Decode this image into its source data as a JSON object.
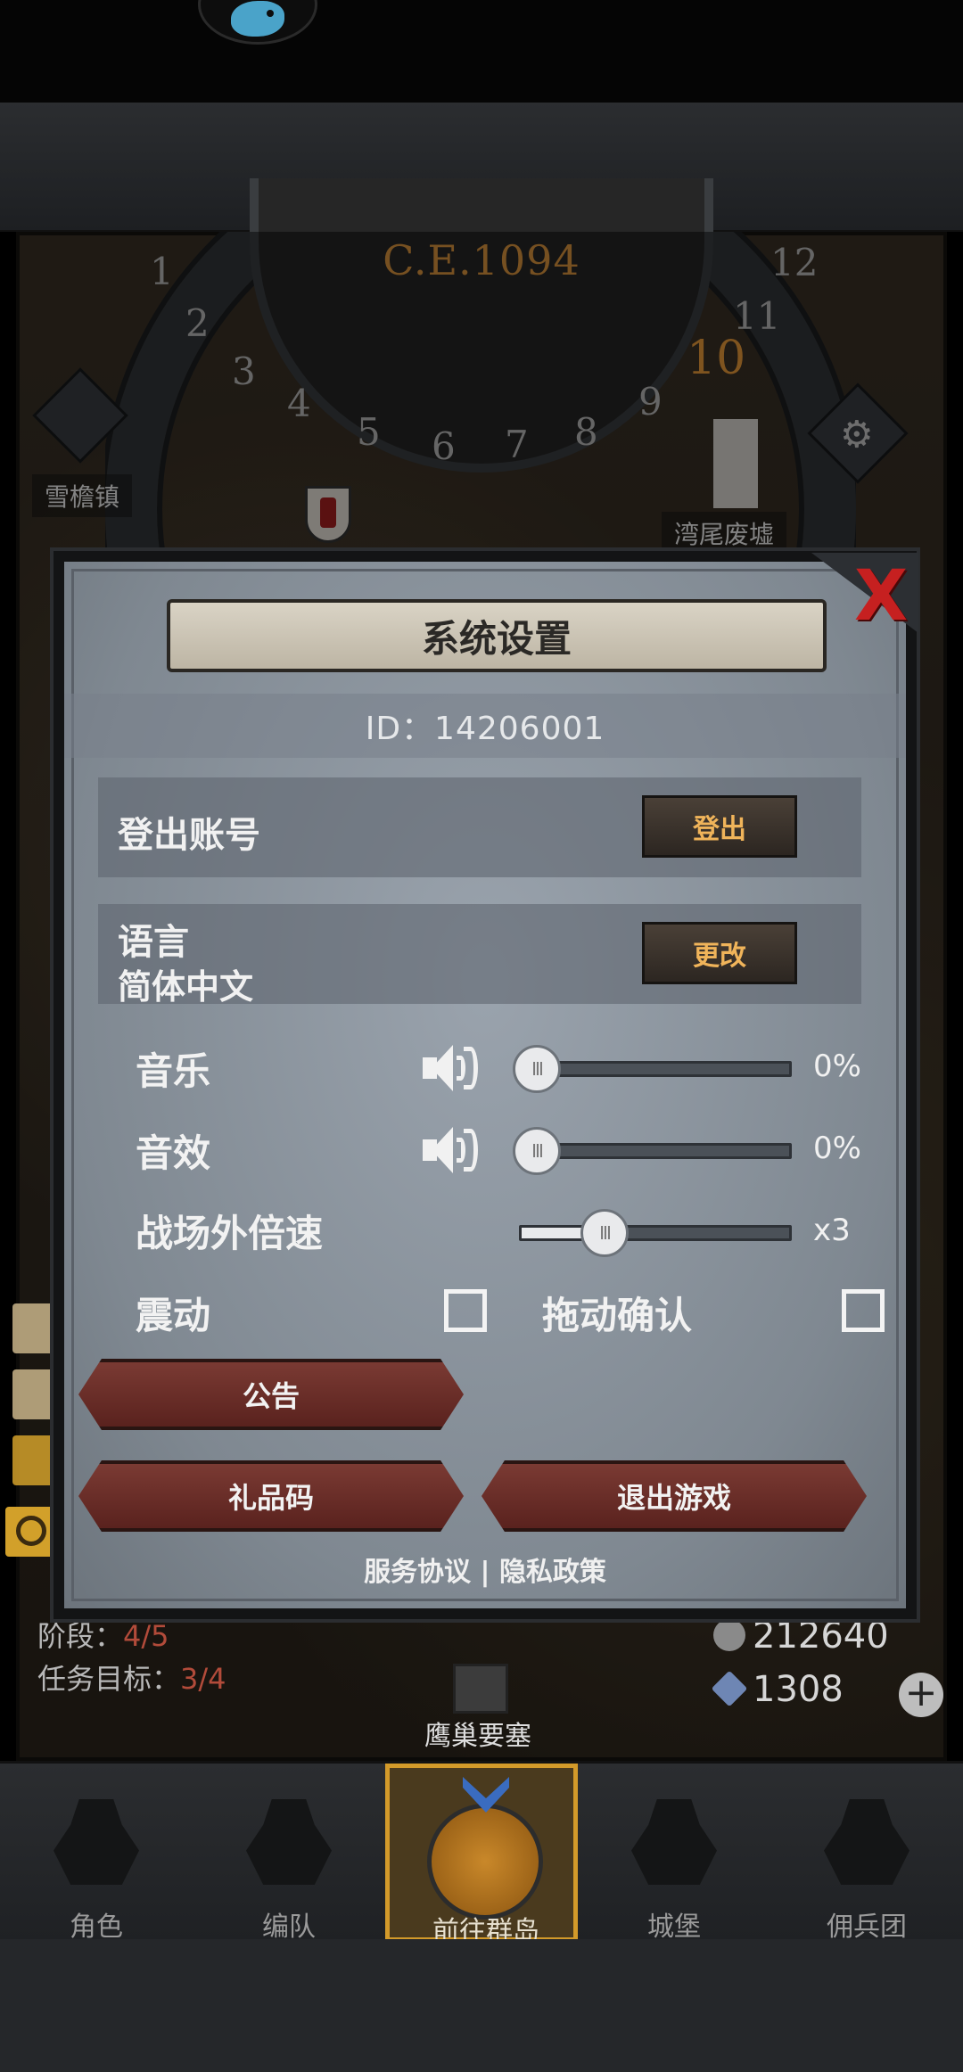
{
  "map": {
    "era": "C.E.1094",
    "months": [
      "1",
      "2",
      "3",
      "4",
      "5",
      "6",
      "7",
      "8",
      "9",
      "10",
      "11",
      "12"
    ],
    "current_month": "10",
    "town_left": "雪檐镇",
    "town_right": "湾尾废墟",
    "fortress": "鹰巢要塞",
    "quest_stage_label": "阶段：",
    "quest_stage_value": "4/5",
    "quest_goal_label": "任务目标：",
    "quest_goal_value": "3/4",
    "silver": "212640",
    "gems": "1308",
    "plus": "+"
  },
  "dialog": {
    "title": "系统设置",
    "id_text": "ID：14206001",
    "logout_label": "登出账号",
    "logout_button": "登出",
    "language_label": "语言",
    "language_value": "简体中文",
    "change_button": "更改",
    "music_label": "音乐",
    "music_value": "0%",
    "music_level": 0,
    "sfx_label": "音效",
    "sfx_value": "0%",
    "sfx_level": 0,
    "speed_label": "战场外倍速",
    "speed_value": "x3",
    "vibration_label": "震动",
    "vibration_checked": false,
    "drag_confirm_label": "拖动确认",
    "drag_confirm_checked": false,
    "notice_button": "公告",
    "gift_code_button": "礼品码",
    "exit_button": "退出游戏",
    "service_link": "服务协议",
    "separator": "|",
    "privacy_link": "隐私政策",
    "close": "X"
  },
  "nav": {
    "items": [
      {
        "label": "角色"
      },
      {
        "label": "编队"
      },
      {
        "label": "前往群岛"
      },
      {
        "label": "城堡"
      },
      {
        "label": "佣兵团"
      }
    ],
    "active_index": 2
  },
  "colors": {
    "accent_gold": "#d39a2a",
    "close_red": "#c62020",
    "button_red": "#6a2d27"
  }
}
